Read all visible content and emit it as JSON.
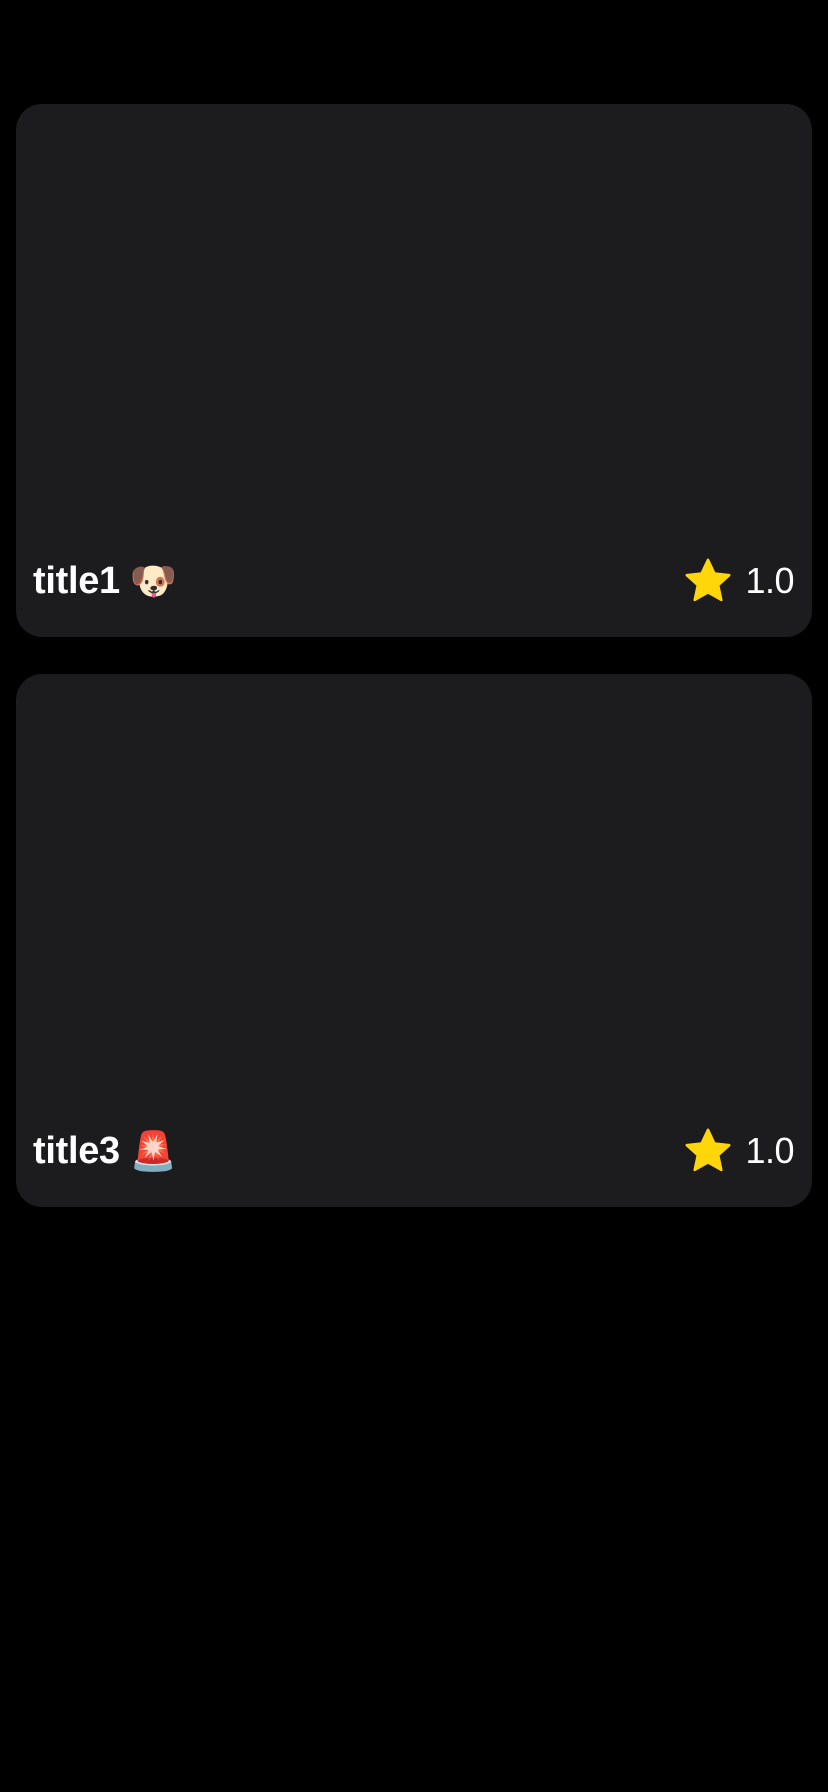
{
  "colors": {
    "background": "#000000",
    "card": "#1c1c1e",
    "star": "#ffd60a",
    "text": "#ffffff"
  },
  "cards": [
    {
      "title": "title1",
      "emoji": "🐶",
      "emoji_icon": "dog-face-icon",
      "rating": "1.0"
    },
    {
      "title": "title3",
      "emoji": "🚨",
      "emoji_icon": "siren-light-icon",
      "rating": "1.0"
    }
  ]
}
